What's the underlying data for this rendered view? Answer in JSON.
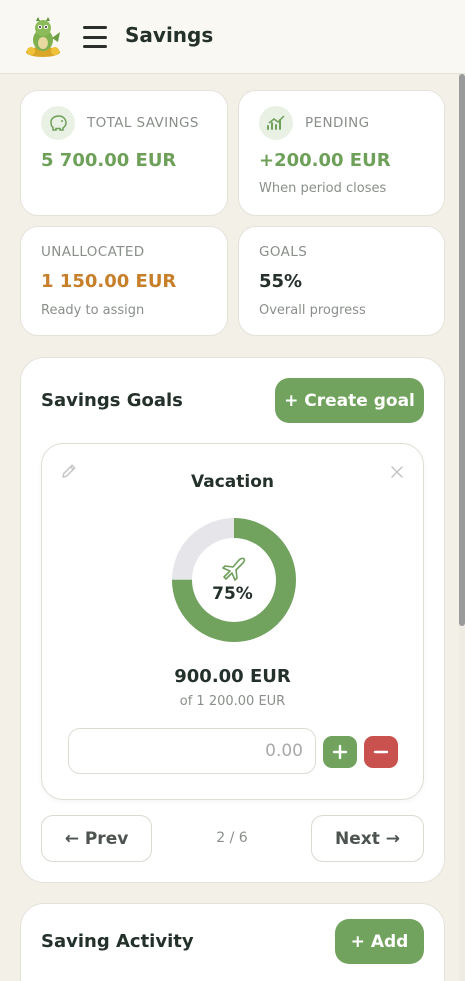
{
  "header": {
    "title": "Savings",
    "logo_icon": "dragon-logo-icon",
    "menu_icon": "hamburger-menu-icon"
  },
  "stats": {
    "total": {
      "label": "TOTAL SAVINGS",
      "value": "5 700.00 EUR",
      "icon": "piggy-bank-icon"
    },
    "pending": {
      "label": "PENDING",
      "value": "+200.00 EUR",
      "sub": "When period closes",
      "icon": "growth-chart-icon"
    },
    "unallocated": {
      "label": "UNALLOCATED",
      "value": "1 150.00 EUR",
      "sub": "Ready to assign"
    },
    "goals": {
      "label": "GOALS",
      "value": "55%",
      "sub": "Overall progress"
    }
  },
  "savings_goals": {
    "title": "Savings Goals",
    "create_button": "+ Create goal",
    "goal": {
      "name": "Vacation",
      "icon": "airplane-icon",
      "percent_label": "75%",
      "progress": 0.75,
      "amount": "900.00 EUR",
      "target": "of 1 200.00 EUR",
      "input_placeholder": "0.00",
      "edit_icon": "pencil-icon",
      "close_icon": "close-icon"
    },
    "pager": {
      "prev": "← Prev",
      "next": "Next →",
      "position": "2 / 6"
    }
  },
  "activity": {
    "title": "Saving Activity",
    "add_button": "+ Add"
  },
  "colors": {
    "accent": "#72a35e",
    "danger": "#c9524e",
    "warning": "#c87f2a",
    "background": "#f3f0e8"
  }
}
